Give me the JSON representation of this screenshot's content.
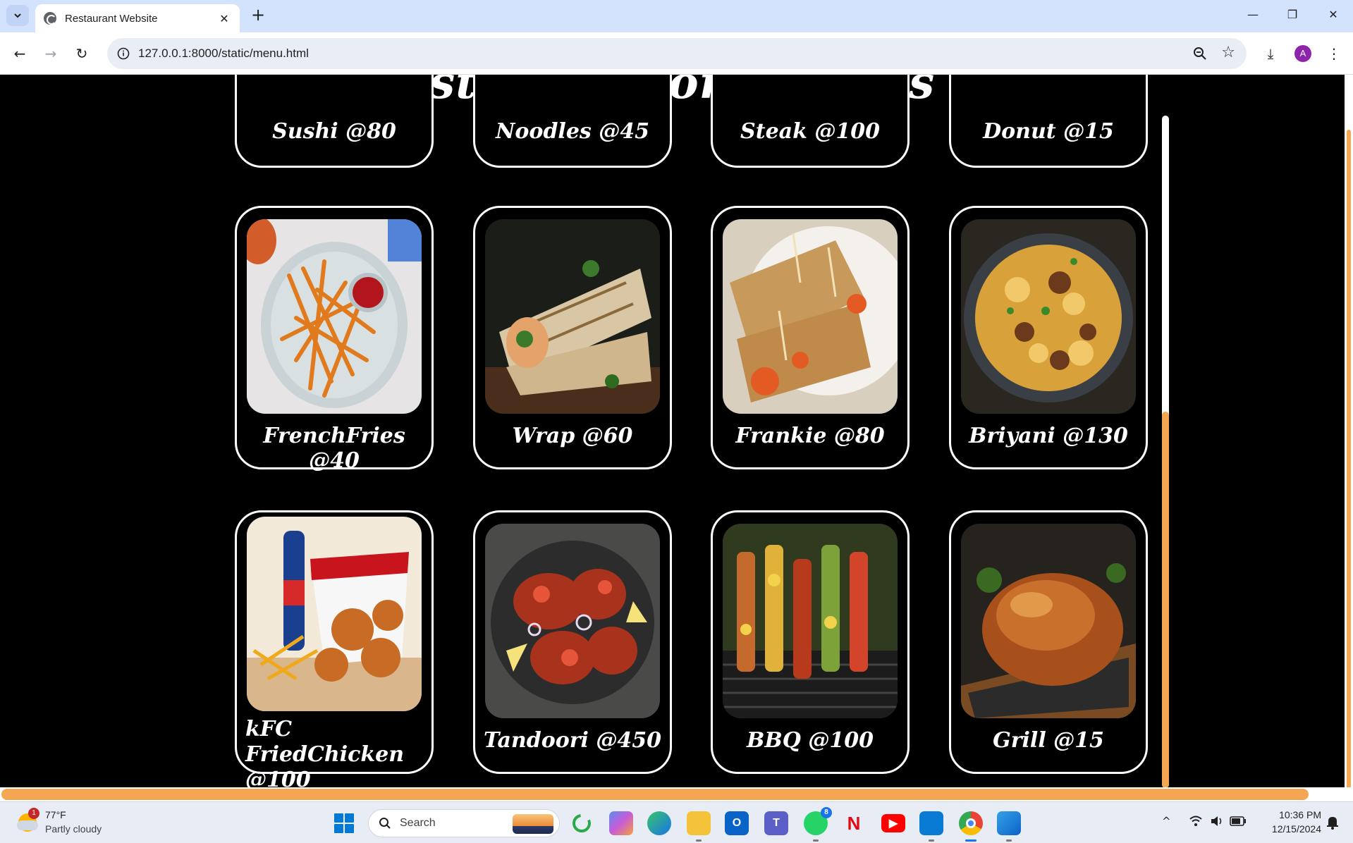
{
  "browser": {
    "tab_title": "Restaurant Website",
    "url": "127.0.0.1:8000/static/menu.html",
    "profile_initial": "A",
    "new_tab_label": "+",
    "tab_close_label": "✕",
    "window_controls": {
      "minimize": "—",
      "restore": "❐",
      "close": "✕"
    },
    "nav": {
      "back": "←",
      "forward": "→",
      "reload": "↻"
    },
    "star": "☆",
    "download": "⤓",
    "menu": "⋮"
  },
  "page": {
    "headline": "\"A Feast of Flavors Awaits You!\"",
    "menu_rows": [
      [
        {
          "name": "Sushi @80",
          "image_icon": "sushi-image"
        },
        {
          "name": "Noodles @45",
          "image_icon": "noodles-image"
        },
        {
          "name": "Steak @100",
          "image_icon": "steak-image"
        },
        {
          "name": "Donut @15",
          "image_icon": "donut-image"
        }
      ],
      [
        {
          "name": "FrenchFries @40",
          "image_icon": "french-fries-image"
        },
        {
          "name": "Wrap @60",
          "image_icon": "wrap-image"
        },
        {
          "name": "Frankie @80",
          "image_icon": "frankie-image"
        },
        {
          "name": "Briyani @130",
          "image_icon": "biryani-image"
        }
      ],
      [
        {
          "name": "kFC FriedChicken @100",
          "image_icon": "fried-chicken-image"
        },
        {
          "name": "Tandoori @450",
          "image_icon": "tandoori-image"
        },
        {
          "name": "BBQ @100",
          "image_icon": "bbq-image"
        },
        {
          "name": "Grill @15",
          "image_icon": "grill-image"
        }
      ]
    ]
  },
  "colors": {
    "page_bg": "#000000",
    "card_border": "#ffffff",
    "scrollbar_thumb": "#f4a653",
    "tabbar_bg": "#d3e3fd"
  },
  "taskbar": {
    "weather_badge": "1",
    "temperature": "77°F",
    "condition": "Partly cloudy",
    "search_label": "Search",
    "whatsapp_badge": "8",
    "time": "10:36 PM",
    "date": "12/15/2024",
    "tray_chevron": "^",
    "icons": [
      "windows-start",
      "copilot",
      "copilot-color",
      "edge",
      "file-explorer",
      "outlook",
      "teams",
      "whatsapp",
      "netflix",
      "youtube",
      "vscode",
      "chrome",
      "paint"
    ]
  }
}
